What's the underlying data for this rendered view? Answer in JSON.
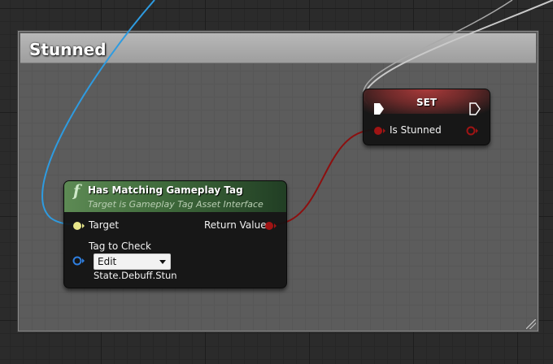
{
  "comment": {
    "title": "Stunned"
  },
  "function_node": {
    "title": "Has Matching Gameplay Tag",
    "subtitle": "Target is Gameplay Tag Asset Interface",
    "icon": "function-icon",
    "inputs": {
      "target_label": "Target",
      "tag_label": "Tag to Check"
    },
    "outputs": {
      "return_label": "Return Value"
    },
    "tag_dropdown": {
      "selected": "Edit"
    },
    "tag_value": "State.Debuff.Stun"
  },
  "set_node": {
    "title": "SET",
    "variable_label": "Is Stunned"
  },
  "colors": {
    "object_wire": "#2e9be0",
    "exec_wire": "#cfcfcf",
    "bool_wire": "#8c0f0f",
    "bool_pin": "#a01414",
    "struct_pin": "#2f7fe0",
    "target_pin": "#e8e68a",
    "comment_header": "#a8a8a8",
    "function_header": "#4f7d47"
  }
}
